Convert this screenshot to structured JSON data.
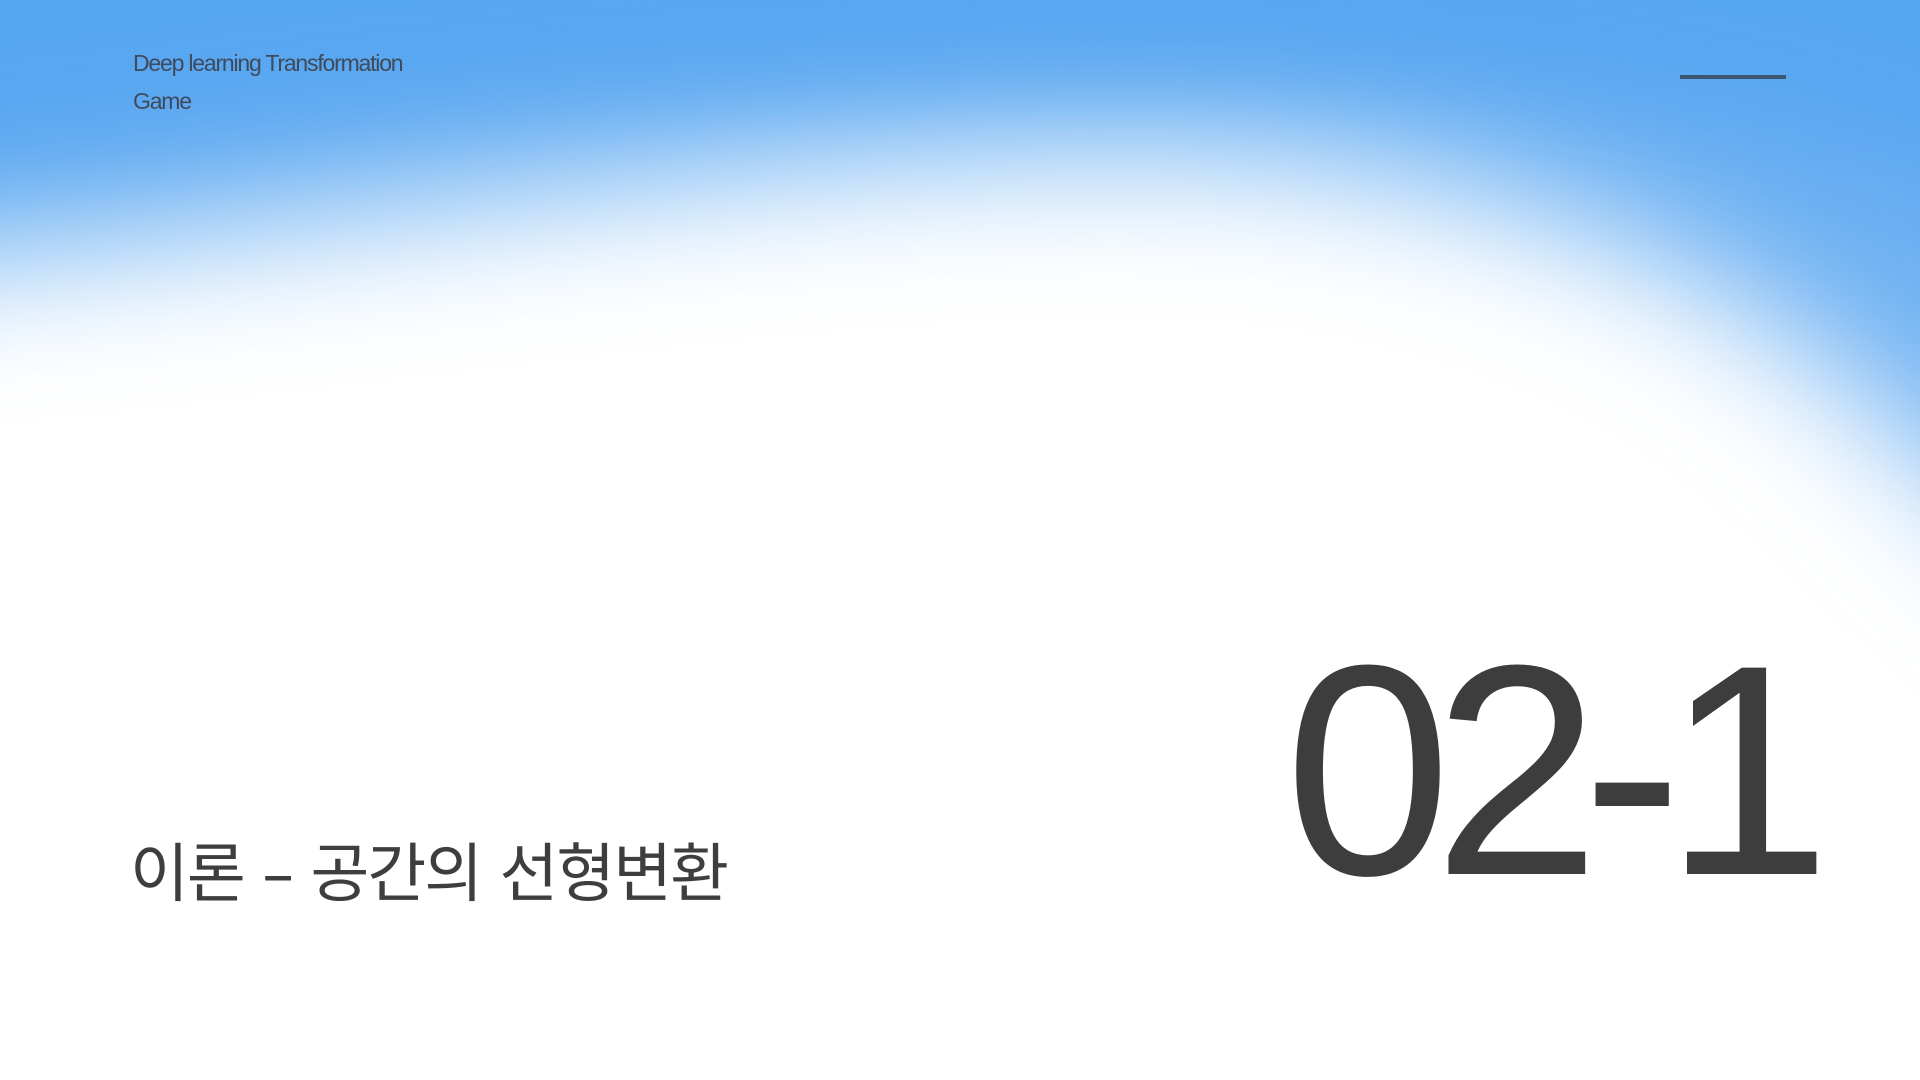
{
  "header": {
    "line1": "Deep learning Transformation",
    "line2": "Game"
  },
  "subtitle": "이론 – 공간의 선형변환",
  "section_number": "02-1",
  "colors": {
    "sky_blue": "#57a6f1",
    "text_dark": "#3d3d3d",
    "accent_line": "#3d5670",
    "background": "#ffffff"
  }
}
